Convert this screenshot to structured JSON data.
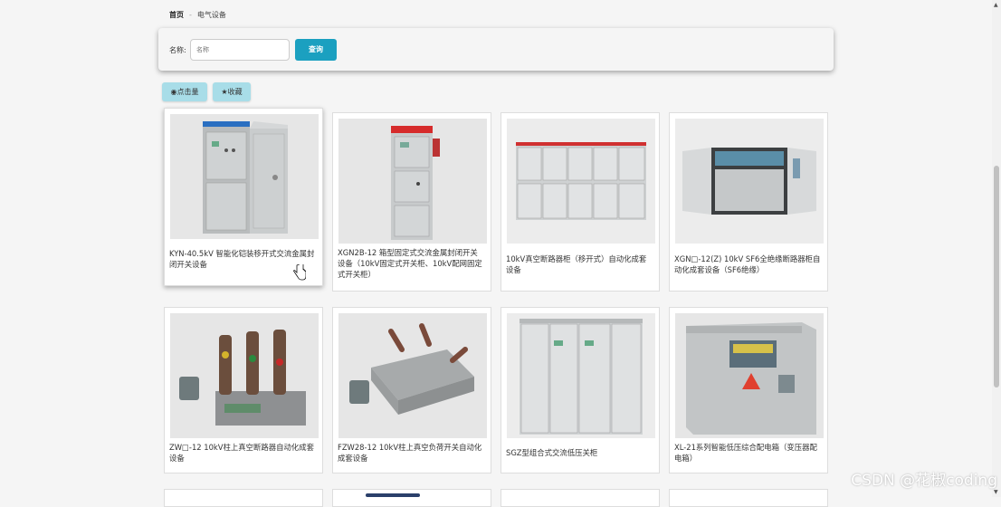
{
  "breadcrumb": {
    "home": "首页",
    "separator": "-",
    "current": "电气设备"
  },
  "search": {
    "label": "名称:",
    "placeholder": "名称",
    "button": "查询"
  },
  "sort": {
    "views": "点击量",
    "favorites": "收藏",
    "views_icon": "eye-icon",
    "favorites_icon": "star-icon"
  },
  "products": [
    {
      "caption": "KYN-40.5kV 智能化铠装移开式交流金属封闭开关设备"
    },
    {
      "caption": "XGN2B-12 箱型固定式交流金属封闭开关设备（10kV固定式开关柜、10kV配网固定式开关柜）"
    },
    {
      "caption": "10kV真空断路器柜（移开式）自动化成套设备"
    },
    {
      "caption": "XGN□-12(Z) 10kV SF6全绝缘断路器柜自动化成套设备（SF6绝缘）"
    },
    {
      "caption": "ZW□-12 10kV柱上真空断路器自动化成套设备"
    },
    {
      "caption": "FZW28-12 10kV柱上真空负荷开关自动化成套设备"
    },
    {
      "caption": "SGZ型组合式交流低压关柜"
    },
    {
      "caption": "XL-21系列智能低压综合配电箱（变压器配电箱）"
    }
  ],
  "watermark": "CSDN @花椒coding",
  "colors": {
    "query_button": "#1ba0c0",
    "sort_button": "#a8dde8",
    "background": "#f5f5f5"
  }
}
